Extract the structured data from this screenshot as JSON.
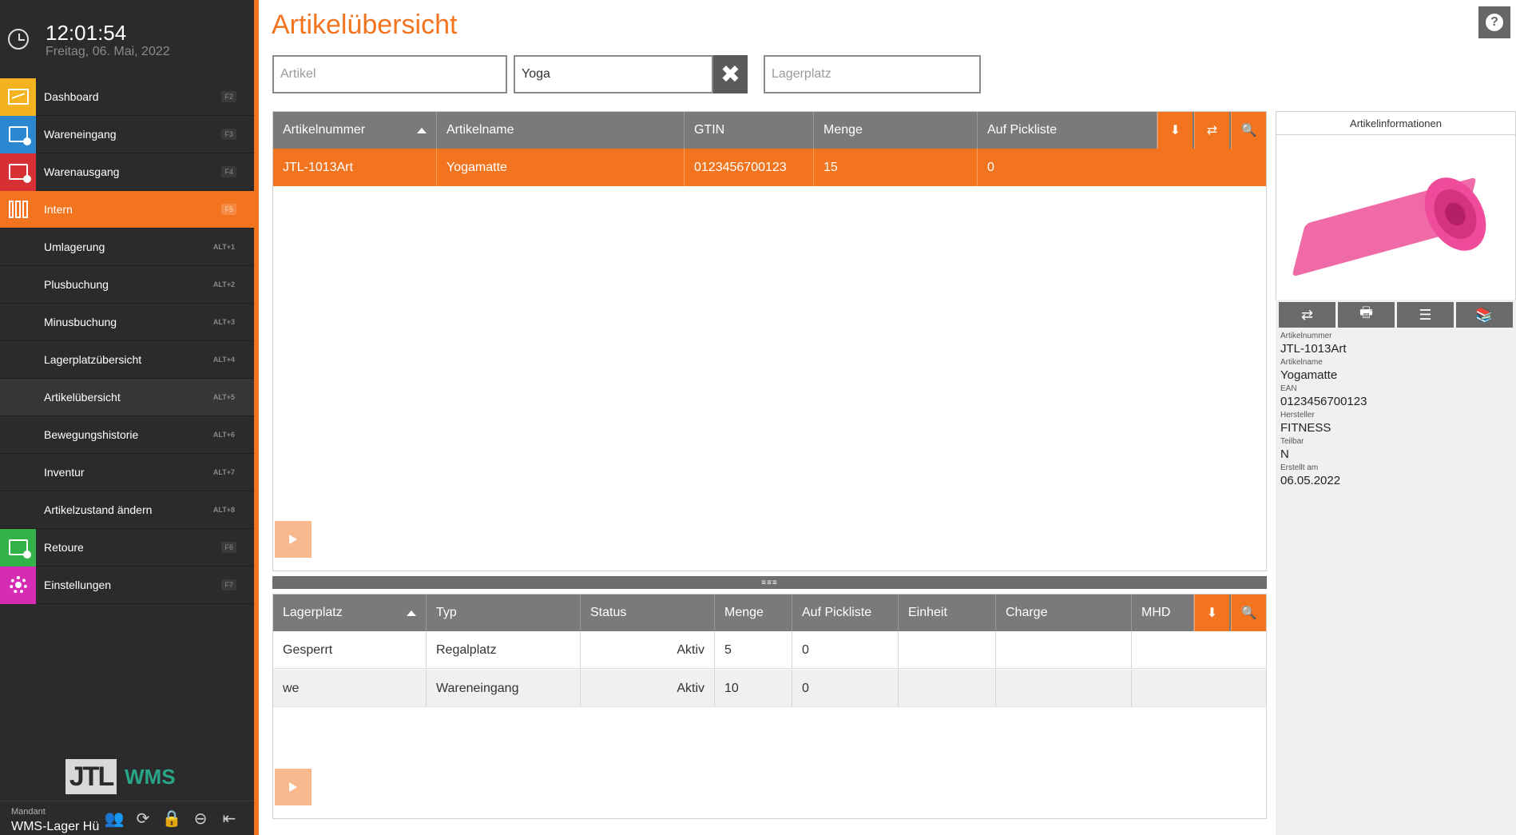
{
  "clock": {
    "time": "12:01:54",
    "date": "Freitag, 06. Mai, 2022"
  },
  "colors": {
    "accent": "#f2741f",
    "dashboard": "#f2b31f",
    "wareneingang": "#2a87d0",
    "warenausgang": "#d63035",
    "retoure": "#34b24a",
    "einstellungen": "#d62cb4",
    "sidebar": "#2b2b2b"
  },
  "nav": {
    "dashboard": {
      "label": "Dashboard",
      "key": "F2",
      "icon": "chart-icon"
    },
    "wareneingang": {
      "label": "Wareneingang",
      "key": "F3",
      "icon": "inbox-icon"
    },
    "warenausgang": {
      "label": "Warenausgang",
      "key": "F4",
      "icon": "outbox-icon"
    },
    "intern": {
      "label": "Intern",
      "key": "F5",
      "icon": "books-icon"
    },
    "umlagerung": {
      "label": "Umlagerung",
      "key": "ALT+1"
    },
    "plusbuchung": {
      "label": "Plusbuchung",
      "key": "ALT+2"
    },
    "minusbuchung": {
      "label": "Minusbuchung",
      "key": "ALT+3"
    },
    "lagerplatz": {
      "label": "Lagerplatzübersicht",
      "key": "ALT+4"
    },
    "artikel": {
      "label": "Artikelübersicht",
      "key": "ALT+5"
    },
    "bewegung": {
      "label": "Bewegungshistorie",
      "key": "ALT+6"
    },
    "inventur": {
      "label": "Inventur",
      "key": "ALT+7"
    },
    "zustand": {
      "label": "Artikelzustand ändern",
      "key": "ALT+8"
    },
    "retoure": {
      "label": "Retoure",
      "key": "F6",
      "icon": "return-icon"
    },
    "einstellungen": {
      "label": "Einstellungen",
      "key": "F7",
      "icon": "gear-icon"
    }
  },
  "logo": {
    "jtl": "JTL",
    "wms": "WMS"
  },
  "footer": {
    "mandant_label": "Mandant",
    "mandant_value": "WMS-Lager Hü"
  },
  "page": {
    "title": "Artikelübersicht"
  },
  "filters": {
    "artikel": {
      "placeholder": "Artikel",
      "value": ""
    },
    "name": {
      "placeholder": "",
      "value": "Yoga"
    },
    "lagerplatz": {
      "placeholder": "Lagerplatz",
      "value": ""
    }
  },
  "top_grid": {
    "headers": [
      "Artikelnummer",
      "Artikelname",
      "GTIN",
      "Menge",
      "Auf Pickliste"
    ],
    "rows": [
      [
        "JTL-1013Art",
        "Yogamatte",
        "0123456700123",
        "15",
        "0"
      ]
    ]
  },
  "bottom_grid": {
    "headers": [
      "Lagerplatz",
      "Typ",
      "Status",
      "Menge",
      "Auf Pickliste",
      "Einheit",
      "Charge",
      "MHD"
    ],
    "rows": [
      [
        "Gesperrt",
        "Regalplatz",
        "Aktiv",
        "5",
        "0",
        "",
        "",
        ""
      ],
      [
        "we",
        "Wareneingang",
        "Aktiv",
        "10",
        "0",
        "",
        "",
        ""
      ]
    ]
  },
  "splitter": "≡≡≡",
  "info": {
    "header": "Artikelinformationen",
    "fields": [
      {
        "k": "Artikelnummer",
        "v": "JTL-1013Art"
      },
      {
        "k": "Artikelname",
        "v": "Yogamatte"
      },
      {
        "k": "EAN",
        "v": "0123456700123"
      },
      {
        "k": "Hersteller",
        "v": "FITNESS"
      },
      {
        "k": "Teilbar",
        "v": "N"
      },
      {
        "k": "Erstellt am",
        "v": "06.05.2022"
      }
    ]
  }
}
